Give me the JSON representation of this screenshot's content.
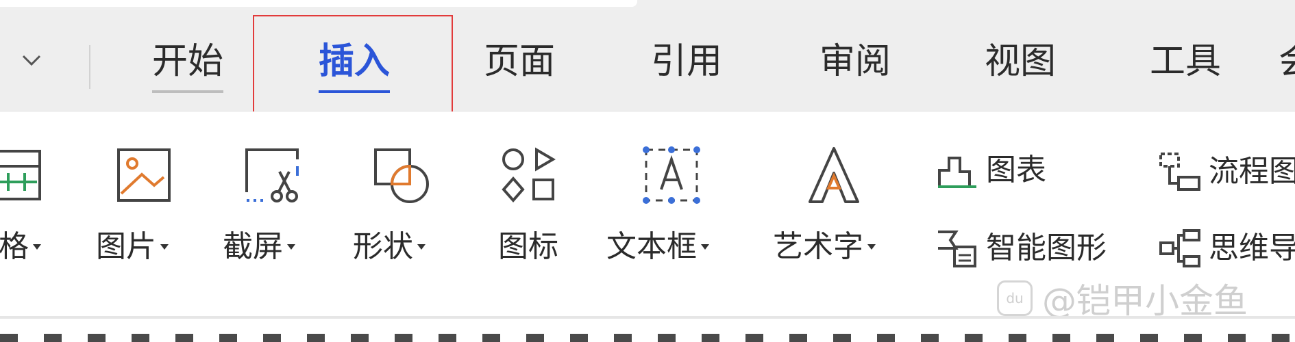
{
  "tabs": [
    {
      "label": "开始",
      "state": "visited"
    },
    {
      "label": "插入",
      "state": "active"
    },
    {
      "label": "页面",
      "state": "normal"
    },
    {
      "label": "引用",
      "state": "normal"
    },
    {
      "label": "审阅",
      "state": "normal"
    },
    {
      "label": "视图",
      "state": "normal"
    },
    {
      "label": "工具",
      "state": "normal"
    },
    {
      "label": "会",
      "state": "normal"
    }
  ],
  "ribbon": {
    "table_label": "格",
    "picture_label": "图片",
    "screenshot_label": "截屏",
    "shape_label": "形状",
    "icons_label": "图标",
    "textbox_label": "文本框",
    "wordart_label": "艺术字",
    "chart_label": "图表",
    "smartart_label": "智能图形",
    "flowchart_label": "流程图",
    "mindmap_label": "思维导"
  },
  "watermark": {
    "badge": "du",
    "text": "@铠甲小金鱼"
  },
  "colors": {
    "accent": "#2b55d8",
    "highlight_box": "#e23b3b",
    "icon_orange": "#e07a2e",
    "icon_green": "#2e9e5b",
    "icon_blue": "#3b6fd8"
  }
}
